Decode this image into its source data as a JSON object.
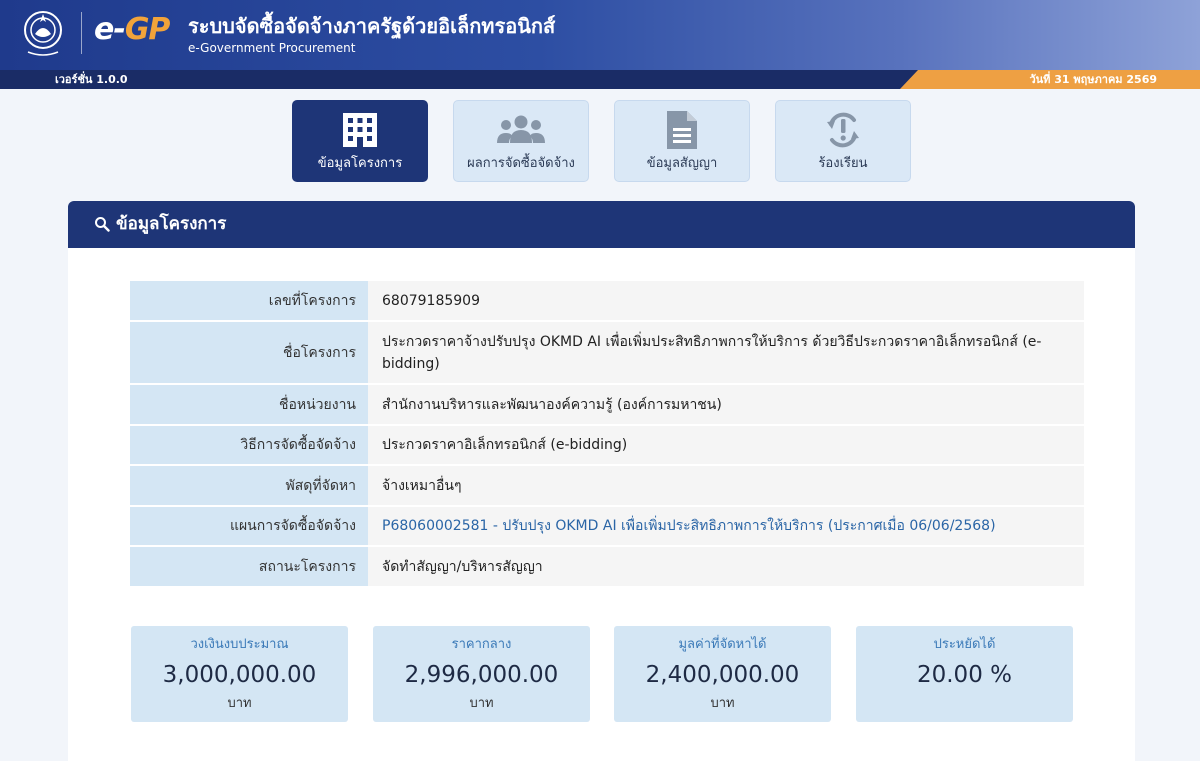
{
  "header": {
    "logo_e": "e",
    "logo_dash": "-",
    "logo_gp": "GP",
    "system_title": "ระบบจัดซื้อจัดจ้างภาครัฐด้วยอิเล็กทรอนิกส์",
    "system_subtitle": "e-Government Procurement",
    "version": "เวอร์ชั่น 1.0.0",
    "date": "วันที่ 31 พฤษภาคม 2569"
  },
  "tabs": [
    {
      "label": "ข้อมูลโครงการ",
      "icon": "building-icon",
      "active": true
    },
    {
      "label": "ผลการจัดซื้อจัดจ้าง",
      "icon": "users-icon",
      "active": false
    },
    {
      "label": "ข้อมูลสัญญา",
      "icon": "document-icon",
      "active": false
    },
    {
      "label": "ร้องเรียน",
      "icon": "complaint-refresh-icon",
      "active": false
    }
  ],
  "panel": {
    "title": "ข้อมูลโครงการ",
    "icon": "search-icon"
  },
  "project_info": [
    {
      "label": "เลขที่โครงการ",
      "value": "68079185909"
    },
    {
      "label": "ชื่อโครงการ",
      "value": "ประกวดราคาจ้างปรับปรุง OKMD AI เพื่อเพิ่มประสิทธิภาพการให้บริการ ด้วยวิธีประกวดราคาอิเล็กทรอนิกส์ (e-bidding)"
    },
    {
      "label": "ชื่อหน่วยงาน",
      "value": "สำนักงานบริหารและพัฒนาองค์ความรู้ (องค์การมหาชน)"
    },
    {
      "label": "วิธีการจัดซื้อจัดจ้าง",
      "value": "ประกวดราคาอิเล็กทรอนิกส์ (e-bidding)"
    },
    {
      "label": "พัสดุที่จัดหา",
      "value": "จ้างเหมาอื่นๆ"
    },
    {
      "label": "แผนการจัดซื้อจัดจ้าง",
      "value": "P68060002581 - ปรับปรุง OKMD AI เพื่อเพิ่มประสิทธิภาพการให้บริการ (ประกาศเมื่อ 06/06/2568)"
    },
    {
      "label": "สถานะโครงการ",
      "value": "จัดทำสัญญา/บริหารสัญญา"
    }
  ],
  "summary": [
    {
      "title": "วงเงินงบประมาณ",
      "value": "3,000,000.00",
      "unit": "บาท"
    },
    {
      "title": "ราคากลาง",
      "value": "2,996,000.00",
      "unit": "บาท"
    },
    {
      "title": "มูลค่าที่จัดหาได้",
      "value": "2,400,000.00",
      "unit": "บาท"
    },
    {
      "title": "ประหยัดได้",
      "value": "20.00 %",
      "unit": ""
    }
  ],
  "colors": {
    "primary_navy": "#1e3577",
    "accent_orange": "#eea043",
    "label_bg": "#d4e6f4",
    "link_blue": "#2a65a6"
  }
}
